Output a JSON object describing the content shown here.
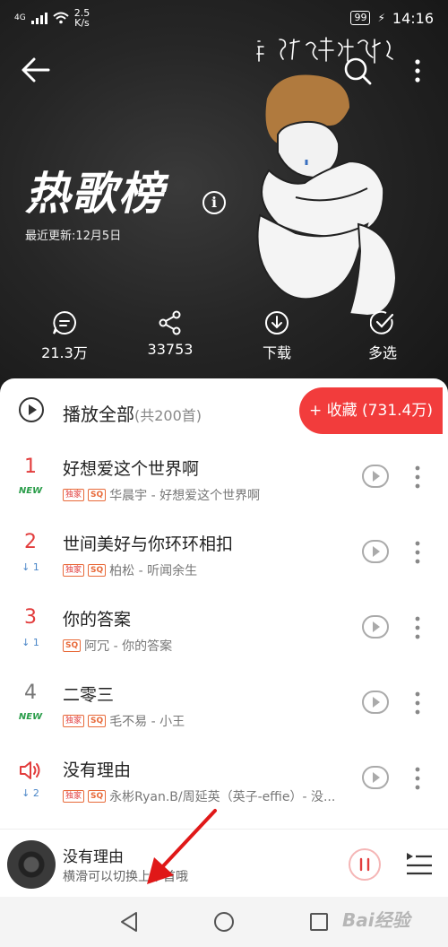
{
  "status_bar": {
    "network": "4G",
    "speed_value": "2.5",
    "speed_unit": "K/s",
    "battery": "99",
    "time": "14:16"
  },
  "header": {
    "title": "热歌榜",
    "update_text": "最近更新:12月5日",
    "info_glyph": "i",
    "artwork_handwriting": "晨宇 好想爱这个世界啊",
    "actions": [
      {
        "icon": "comment-icon",
        "label": "21.3万"
      },
      {
        "icon": "share-icon",
        "label": "33753"
      },
      {
        "icon": "download-icon",
        "label": "下载"
      },
      {
        "icon": "multi-select-icon",
        "label": "多选"
      }
    ]
  },
  "playlist": {
    "play_all_label": "播放全部",
    "play_all_count": "(共200首)",
    "collect_label": "+ 收藏 (731.4万)"
  },
  "songs": [
    {
      "rank": "1",
      "trend": "NEW",
      "title": "好想爱这个世界啊",
      "tags": [
        "独家",
        "SQ"
      ],
      "meta": "华晨宇 - 好想爱这个世界啊"
    },
    {
      "rank": "2",
      "trend": "↓ 1",
      "title": "世间美好与你环环相扣",
      "tags": [
        "独家",
        "SQ"
      ],
      "meta": "柏松 - 听闻余生"
    },
    {
      "rank": "3",
      "trend": "↓ 1",
      "title": "你的答案",
      "tags": [
        "SQ"
      ],
      "meta": "阿冗 - 你的答案"
    },
    {
      "rank": "4",
      "trend": "NEW",
      "title": "二零三",
      "tags": [
        "独家",
        "SQ"
      ],
      "meta": "毛不易 - 小王"
    },
    {
      "rank": "",
      "trend": "↓ 2",
      "title": "没有理由",
      "tags": [
        "独家",
        "SQ"
      ],
      "meta": "永彬Ryan.B/周延英（英子-effie）- 没..."
    }
  ],
  "mini_player": {
    "title": "没有理由",
    "subtitle": "横滑可以切换上下首哦"
  },
  "watermark": "Bai经验",
  "colors": {
    "accent": "#f23c3c",
    "rank_red": "#e23c3c",
    "trend_new": "#2a9d4a",
    "trend_down": "#4a86c8"
  }
}
